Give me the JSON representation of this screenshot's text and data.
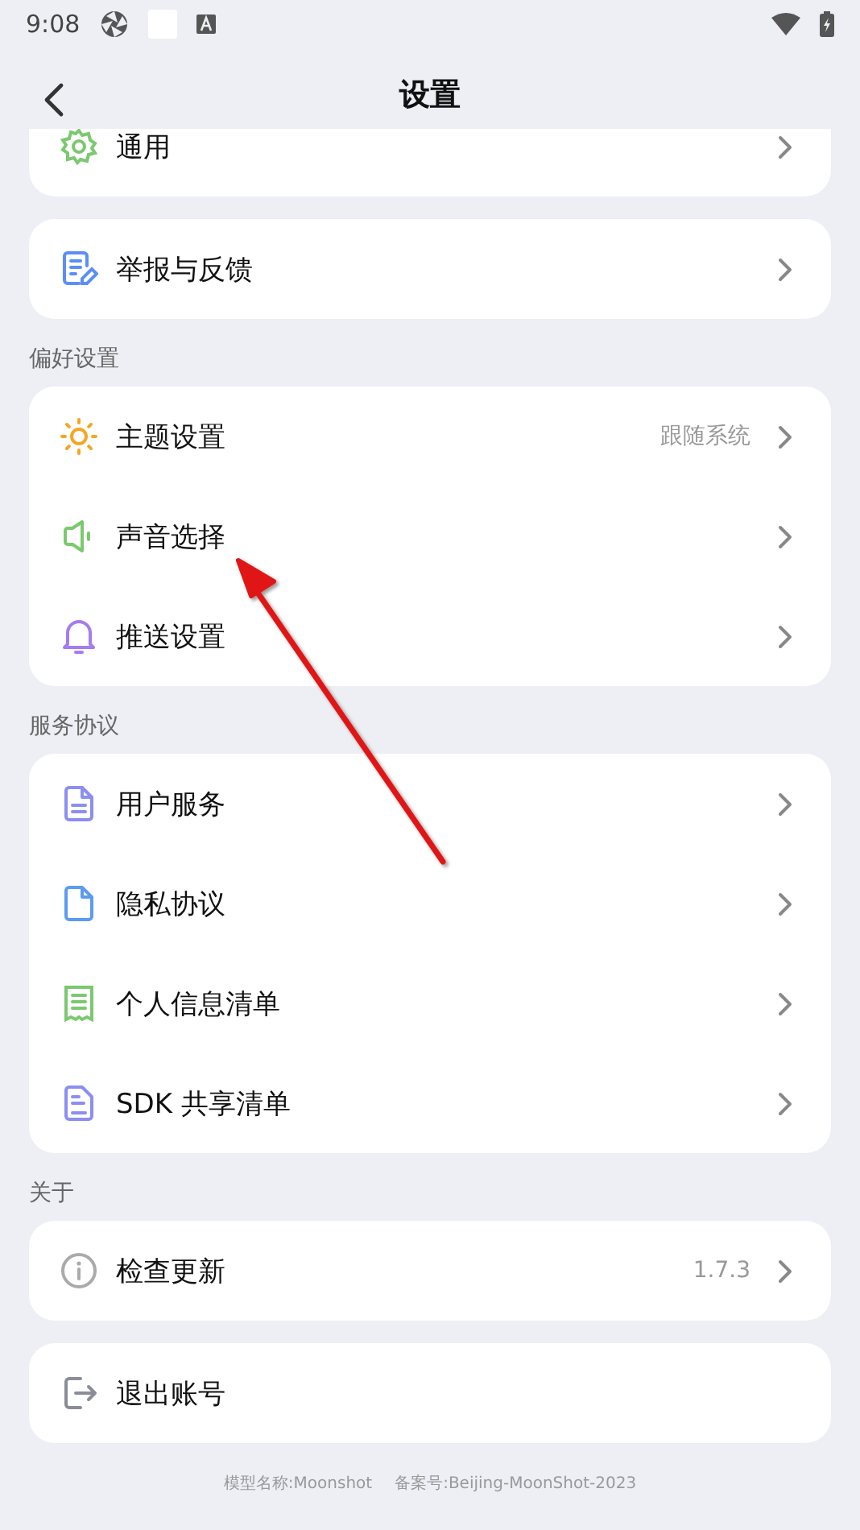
{
  "status_bar": {
    "time": "9:08"
  },
  "header": {
    "title": "设置"
  },
  "groups": [
    {
      "clipped": true,
      "items": [
        {
          "kind": "gear",
          "label": "通用",
          "chevron": true
        }
      ]
    },
    {
      "clipped": false,
      "items": [
        {
          "kind": "feedback",
          "label": "举报与反馈",
          "chevron": true
        }
      ]
    },
    {
      "clipped": false,
      "label": "偏好设置",
      "items": [
        {
          "kind": "sun",
          "label": "主题设置",
          "value": "跟随系统",
          "chevron": true
        },
        {
          "kind": "speaker",
          "label": "声音选择",
          "chevron": true
        },
        {
          "kind": "bell",
          "label": "推送设置",
          "chevron": true
        }
      ]
    },
    {
      "clipped": false,
      "label": "服务协议",
      "items": [
        {
          "kind": "doc",
          "label": "用户服务",
          "chevron": true
        },
        {
          "kind": "page",
          "label": "隐私协议",
          "chevron": true
        },
        {
          "kind": "receipt",
          "label": "个人信息清单",
          "chevron": true
        },
        {
          "kind": "sdk",
          "label": "SDK 共享清单",
          "chevron": true
        }
      ]
    },
    {
      "clipped": false,
      "label": "关于",
      "items": [
        {
          "kind": "info",
          "label": "检查更新",
          "value": "1.7.3",
          "chevron": true
        }
      ]
    },
    {
      "clipped": false,
      "items": [
        {
          "kind": "logout",
          "label": "退出账号",
          "chevron": false
        }
      ]
    }
  ],
  "footer": [
    "模型名称:Moonshot",
    "备案号:Beijing-MoonShot-2023"
  ]
}
